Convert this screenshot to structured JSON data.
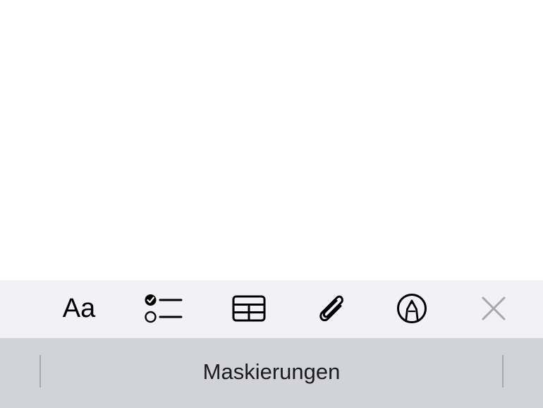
{
  "toolbar": {
    "format_label": "Aa",
    "tools": [
      {
        "name": "format",
        "icon": "text-format-icon"
      },
      {
        "name": "checklist",
        "icon": "checklist-icon"
      },
      {
        "name": "table",
        "icon": "table-icon"
      },
      {
        "name": "attachment",
        "icon": "paperclip-icon"
      },
      {
        "name": "markup",
        "icon": "pen-circle-icon"
      },
      {
        "name": "close",
        "icon": "close-icon"
      }
    ],
    "colors": {
      "background": "#f2f2f6",
      "icon": "#000000",
      "close_icon": "#a7a7ab"
    }
  },
  "keyboard_suggestions": {
    "items": [
      "Maskierungen"
    ],
    "colors": {
      "background": "#d1d3d9",
      "divider": "#a7a9b0"
    }
  }
}
